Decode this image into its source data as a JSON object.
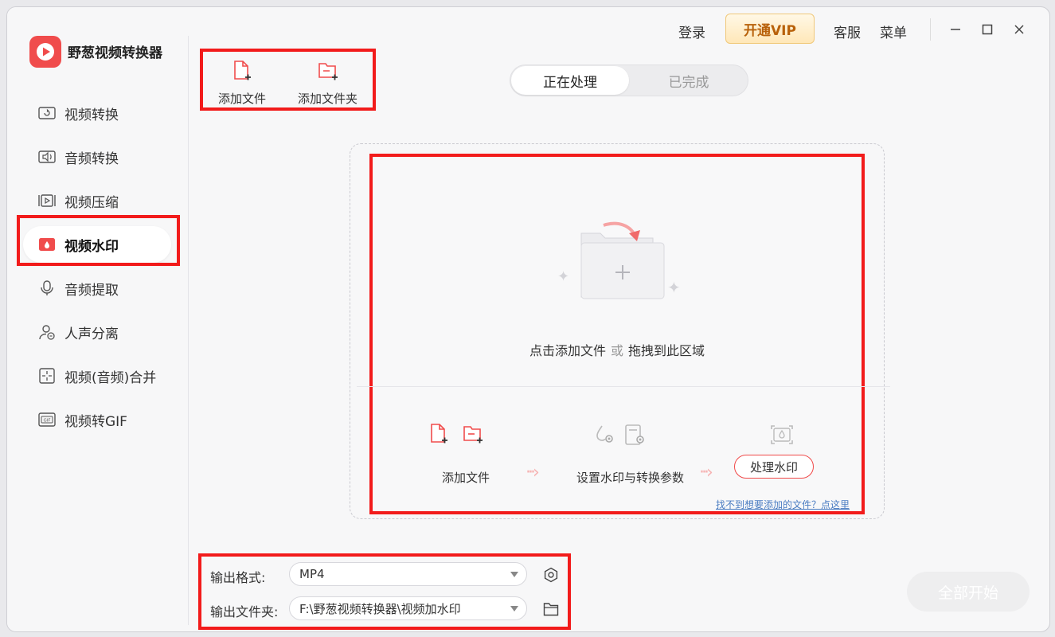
{
  "app": {
    "title": "野葱视频转换器"
  },
  "titlebar": {
    "login": "登录",
    "vip": "开通VIP",
    "service": "客服",
    "menu": "菜单"
  },
  "sidebar": {
    "items": [
      {
        "label": "视频转换",
        "icon": "video-convert-icon"
      },
      {
        "label": "音频转换",
        "icon": "audio-convert-icon"
      },
      {
        "label": "视频压缩",
        "icon": "video-compress-icon"
      },
      {
        "label": "视频水印",
        "icon": "video-watermark-icon",
        "active": true
      },
      {
        "label": "音频提取",
        "icon": "audio-extract-icon"
      },
      {
        "label": "人声分离",
        "icon": "vocal-separate-icon"
      },
      {
        "label": "视频(音频)合并",
        "icon": "merge-icon"
      },
      {
        "label": "视频转GIF",
        "icon": "gif-icon"
      }
    ]
  },
  "toolbar": {
    "add_file": "添加文件",
    "add_folder": "添加文件夹"
  },
  "tabs": {
    "processing": "正在处理",
    "completed": "已完成"
  },
  "dropzone": {
    "click_add": "点击添加文件",
    "or": "或",
    "drag_here": "拖拽到此区域",
    "steps": [
      "添加文件",
      "设置水印与转换参数"
    ],
    "process_button": "处理水印",
    "help_link": "找不到想要添加的文件？点这里"
  },
  "output": {
    "format_label": "输出格式:",
    "format_value": "MP4",
    "folder_label": "输出文件夹:",
    "folder_value": "F:\\野葱视频转换器\\视频加水印"
  },
  "start_all": "全部开始",
  "colors": {
    "accent": "#f04c4c",
    "highlight_box": "#f21b1b",
    "vip_text": "#b8610a"
  }
}
